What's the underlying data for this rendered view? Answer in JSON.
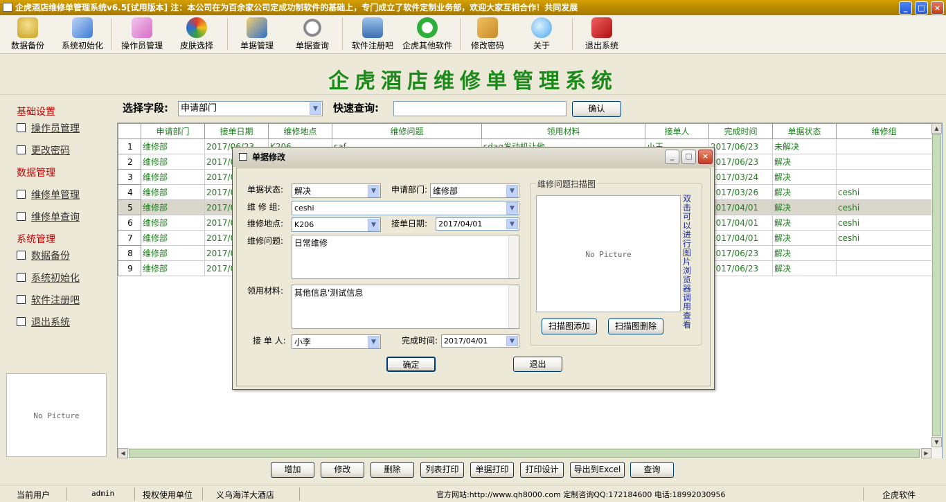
{
  "window": {
    "title": "企虎酒店维修单管理系统v6.5[试用版本] 注：本公司在为百余家公司定成功制软件的基础上，专门成立了软件定制业务部，欢迎大家互相合作！共同发展",
    "controls": [
      "_",
      "□",
      "×"
    ]
  },
  "toolbar": [
    {
      "label": "数据备份",
      "icon": "database-icon",
      "color": "#c9a227"
    },
    {
      "label": "系统初始化",
      "icon": "checklist-icon",
      "color": "#3d7ad6"
    },
    {
      "label": "操作员管理",
      "icon": "user-window-icon",
      "color": "#d86cc8"
    },
    {
      "label": "皮肤选择",
      "icon": "color-ball-icon",
      "color": "#e03a2a"
    },
    {
      "label": "单据管理",
      "icon": "folder-icon",
      "color": "#2f6fcf"
    },
    {
      "label": "单据查询",
      "icon": "magnifier-icon",
      "color": "#8a8a8a"
    },
    {
      "label": "软件注册吧",
      "icon": "monitor-icon",
      "color": "#3a6fb0"
    },
    {
      "label": "企虎其他软件",
      "icon": "refresh-icon",
      "color": "#2fae3a"
    },
    {
      "label": "修改密码",
      "icon": "key-icon",
      "color": "#c88a2a"
    },
    {
      "label": "关于",
      "icon": "chat-icon",
      "color": "#4aa6e8"
    },
    {
      "label": "退出系统",
      "icon": "exit-cube-icon",
      "color": "#d42020"
    }
  ],
  "app_title": "企虎酒店维修单管理系统",
  "sidebar": {
    "groups": [
      {
        "header": "基础设置",
        "items": [
          "操作员管理",
          "更改密码"
        ]
      },
      {
        "header": "数据管理",
        "items": [
          "维修单管理",
          "维修单查询"
        ]
      },
      {
        "header": "系统管理",
        "items": [
          "数据备份",
          "系统初始化",
          "软件注册吧",
          "退出系统"
        ]
      }
    ],
    "picture_text": "No Picture"
  },
  "search": {
    "field_label": "选择字段:",
    "field_value": "申请部门",
    "quick_label": "快速查询:",
    "quick_value": "",
    "confirm_label": "确认"
  },
  "table": {
    "columns": [
      "申请部门",
      "接单日期",
      "维修地点",
      "维修问题",
      "领用材料",
      "接单人",
      "完成时间",
      "单据状态",
      "维修组"
    ],
    "rows": [
      {
        "n": "1",
        "cells": [
          "维修部",
          "2017/06/23",
          "K206",
          "saf",
          "sdag发动机让他",
          "小王",
          "2017/06/23",
          "未解决",
          ""
        ]
      },
      {
        "n": "2",
        "cells": [
          "维修部",
          "2017/06",
          "",
          "",
          "",
          "",
          "2017/06/23",
          "解决",
          ""
        ]
      },
      {
        "n": "3",
        "cells": [
          "维修部",
          "2017/03",
          "",
          "",
          "",
          "",
          "2017/03/24",
          "解决",
          ""
        ]
      },
      {
        "n": "4",
        "cells": [
          "维修部",
          "2017/03",
          "",
          "",
          "",
          "",
          "2017/03/26",
          "解决",
          "ceshi"
        ]
      },
      {
        "n": "5",
        "cells": [
          "维修部",
          "2017/04",
          "",
          "",
          "",
          "",
          "2017/04/01",
          "解决",
          "ceshi"
        ]
      },
      {
        "n": "6",
        "cells": [
          "维修部",
          "2017/04",
          "",
          "",
          "",
          "",
          "2017/04/01",
          "解决",
          "ceshi"
        ]
      },
      {
        "n": "7",
        "cells": [
          "维修部",
          "2017/04",
          "",
          "",
          "",
          "",
          "2017/04/01",
          "解决",
          "ceshi"
        ]
      },
      {
        "n": "8",
        "cells": [
          "维修部",
          "2017/06",
          "",
          "",
          "",
          "",
          "2017/06/23",
          "解决",
          ""
        ]
      },
      {
        "n": "9",
        "cells": [
          "维修部",
          "2017/06",
          "",
          "",
          "",
          "",
          "2017/06/23",
          "解决",
          ""
        ]
      }
    ],
    "selected_row": 5
  },
  "actions": [
    "增加",
    "修改",
    "删除",
    "列表打印",
    "单据打印",
    "打印设计",
    "导出到Excel",
    "查询"
  ],
  "status": {
    "user_label": "当前用户",
    "user": "admin",
    "licensee_label": "授权使用单位",
    "licensee": "义乌海洋大酒店",
    "contact": "官方网站:http://www.qh8000.com 定制咨询QQ:172184600 电话:18992030956",
    "brand": "企虎软件"
  },
  "dialog": {
    "title": "单据修改",
    "status_label": "单据状态:",
    "status_value": "解决",
    "dept_label": "申请部门:",
    "dept_value": "维修部",
    "group_label": "维 修 组:",
    "group_value": "ceshi",
    "location_label": "维修地点:",
    "location_value": "K206",
    "date_label": "接单日期:",
    "date_value": "2017/04/01",
    "issue_label": "维修问题:",
    "issue_value": "日常维修",
    "material_label": "领用材料:",
    "material_value": "其他信息'测试信息",
    "receiver_label": "接 单 人:",
    "receiver_value": "小李",
    "finish_label": "完成时间:",
    "finish_value": "2017/04/01",
    "scan_group_title": "维修问题扫描图",
    "picture_text": "No Picture",
    "scan_hint": "双击可以进行图片浏览器调用查看",
    "scan_add": "扫描图添加",
    "scan_delete": "扫描图删除",
    "ok": "确定",
    "exit": "退出"
  }
}
